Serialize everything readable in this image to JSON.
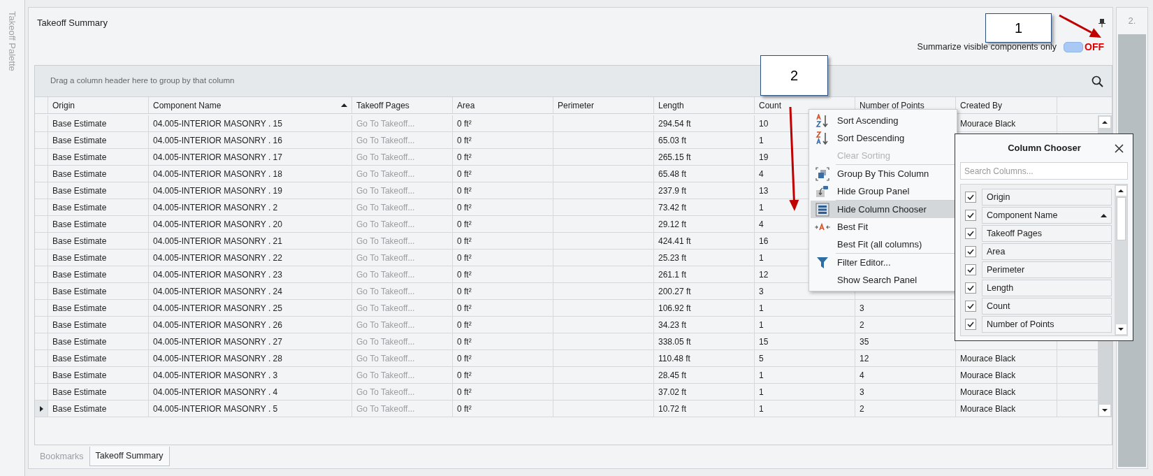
{
  "side_panel": {
    "title": "Takeoff Palette"
  },
  "panel": {
    "title": "Takeoff Summary"
  },
  "summarize": {
    "label": "Summarize visible components only",
    "on": false,
    "state_text": "OFF"
  },
  "callouts": [
    "1",
    "2"
  ],
  "grid": {
    "group_panel_hint": "Drag a column header here to group by that column",
    "columns": [
      {
        "label": "Origin",
        "sorted": false
      },
      {
        "label": "Component Name",
        "sorted": true
      },
      {
        "label": "Takeoff Pages",
        "sorted": false
      },
      {
        "label": "Area",
        "sorted": false
      },
      {
        "label": "Perimeter",
        "sorted": false
      },
      {
        "label": "Length",
        "sorted": false
      },
      {
        "label": "Count",
        "sorted": false
      },
      {
        "label": "Number of Points",
        "sorted": false
      },
      {
        "label": "Created By",
        "sorted": false
      }
    ],
    "rows": [
      {
        "origin": "Base Estimate",
        "component": "04.005-INTERIOR MASONRY . 15",
        "takeoff_pages": "Go To Takeoff...",
        "area": "0 ft²",
        "length": "294.54 ft",
        "count": "10",
        "created_by": "Mourace Black",
        "current": false
      },
      {
        "origin": "Base Estimate",
        "component": "04.005-INTERIOR MASONRY . 16",
        "takeoff_pages": "Go To Takeoff...",
        "area": "0 ft²",
        "length": "65.03 ft",
        "count": "1",
        "current": false
      },
      {
        "origin": "Base Estimate",
        "component": "04.005-INTERIOR MASONRY . 17",
        "takeoff_pages": "Go To Takeoff...",
        "area": "0 ft²",
        "length": "265.15 ft",
        "count": "19",
        "current": false
      },
      {
        "origin": "Base Estimate",
        "component": "04.005-INTERIOR MASONRY . 18",
        "takeoff_pages": "Go To Takeoff...",
        "area": "0 ft²",
        "length": "65.48 ft",
        "count": "4",
        "current": false
      },
      {
        "origin": "Base Estimate",
        "component": "04.005-INTERIOR MASONRY . 19",
        "takeoff_pages": "Go To Takeoff...",
        "area": "0 ft²",
        "length": "237.9 ft",
        "count": "13",
        "current": false
      },
      {
        "origin": "Base Estimate",
        "component": "04.005-INTERIOR MASONRY . 2",
        "takeoff_pages": "Go To Takeoff...",
        "area": "0 ft²",
        "length": "73.42 ft",
        "count": "1",
        "current": false
      },
      {
        "origin": "Base Estimate",
        "component": "04.005-INTERIOR MASONRY . 20",
        "takeoff_pages": "Go To Takeoff...",
        "area": "0 ft²",
        "length": "29.12 ft",
        "count": "4",
        "current": false
      },
      {
        "origin": "Base Estimate",
        "component": "04.005-INTERIOR MASONRY . 21",
        "takeoff_pages": "Go To Takeoff...",
        "area": "0 ft²",
        "length": "424.41 ft",
        "count": "16",
        "current": false
      },
      {
        "origin": "Base Estimate",
        "component": "04.005-INTERIOR MASONRY . 22",
        "takeoff_pages": "Go To Takeoff...",
        "area": "0 ft²",
        "length": "25.23 ft",
        "count": "1",
        "current": false
      },
      {
        "origin": "Base Estimate",
        "component": "04.005-INTERIOR MASONRY . 23",
        "takeoff_pages": "Go To Takeoff...",
        "area": "0 ft²",
        "length": "261.1 ft",
        "count": "12",
        "current": false
      },
      {
        "origin": "Base Estimate",
        "component": "04.005-INTERIOR MASONRY . 24",
        "takeoff_pages": "Go To Takeoff...",
        "area": "0 ft²",
        "length": "200.27 ft",
        "count": "3",
        "current": false
      },
      {
        "origin": "Base Estimate",
        "component": "04.005-INTERIOR MASONRY . 25",
        "takeoff_pages": "Go To Takeoff...",
        "area": "0 ft²",
        "length": "106.92 ft",
        "count": "1",
        "number_of_points": "3",
        "current": false
      },
      {
        "origin": "Base Estimate",
        "component": "04.005-INTERIOR MASONRY . 26",
        "takeoff_pages": "Go To Takeoff...",
        "area": "0 ft²",
        "length": "34.23 ft",
        "count": "1",
        "number_of_points": "2",
        "current": false
      },
      {
        "origin": "Base Estimate",
        "component": "04.005-INTERIOR MASONRY . 27",
        "takeoff_pages": "Go To Takeoff...",
        "area": "0 ft²",
        "length": "338.05 ft",
        "count": "15",
        "number_of_points": "35",
        "current": false
      },
      {
        "origin": "Base Estimate",
        "component": "04.005-INTERIOR MASONRY . 28",
        "takeoff_pages": "Go To Takeoff...",
        "area": "0 ft²",
        "length": "110.48 ft",
        "count": "5",
        "number_of_points": "12",
        "created_by": "Mourace Black",
        "current": false
      },
      {
        "origin": "Base Estimate",
        "component": "04.005-INTERIOR MASONRY . 3",
        "takeoff_pages": "Go To Takeoff...",
        "area": "0 ft²",
        "length": "28.45 ft",
        "count": "1",
        "number_of_points": "4",
        "created_by": "Mourace Black",
        "current": false
      },
      {
        "origin": "Base Estimate",
        "component": "04.005-INTERIOR MASONRY . 4",
        "takeoff_pages": "Go To Takeoff...",
        "area": "0 ft²",
        "length": "37.02 ft",
        "count": "1",
        "number_of_points": "3",
        "created_by": "Mourace Black",
        "current": false
      },
      {
        "origin": "Base Estimate",
        "component": "04.005-INTERIOR MASONRY . 5",
        "takeoff_pages": "Go To Takeoff...",
        "area": "0 ft²",
        "length": "10.72 ft",
        "count": "1",
        "number_of_points": "2",
        "created_by": "Mourace Black",
        "current": true
      }
    ]
  },
  "context_menu": {
    "items": [
      {
        "label": "Sort Ascending",
        "kind": "sort_asc",
        "disabled": false,
        "highlighted": false,
        "separator_before": false
      },
      {
        "label": "Sort Descending",
        "kind": "sort_desc",
        "disabled": false,
        "highlighted": false,
        "separator_before": false
      },
      {
        "label": "Clear Sorting",
        "kind": "plain",
        "disabled": true,
        "highlighted": false,
        "separator_before": false
      },
      {
        "label": "Group By This Column",
        "kind": "group",
        "disabled": false,
        "highlighted": false,
        "separator_before": true
      },
      {
        "label": "Hide Group Panel",
        "kind": "group_panel",
        "disabled": false,
        "highlighted": false,
        "separator_before": false
      },
      {
        "label": "Hide Column Chooser",
        "kind": "column_chooser",
        "disabled": false,
        "highlighted": true,
        "separator_before": true
      },
      {
        "label": "Best Fit",
        "kind": "best_fit",
        "disabled": false,
        "highlighted": false,
        "separator_before": false
      },
      {
        "label": "Best Fit (all columns)",
        "kind": "plain",
        "disabled": false,
        "highlighted": false,
        "separator_before": false
      },
      {
        "label": "Filter Editor...",
        "kind": "filter",
        "disabled": false,
        "highlighted": false,
        "separator_before": true
      },
      {
        "label": "Show Search Panel",
        "kind": "plain",
        "disabled": false,
        "highlighted": false,
        "separator_before": false
      }
    ]
  },
  "column_chooser": {
    "title": "Column Chooser",
    "search_placeholder": "Search Columns...",
    "items": [
      {
        "label": "Origin",
        "checked": true,
        "sorted": false
      },
      {
        "label": "Component Name",
        "checked": true,
        "sorted": true
      },
      {
        "label": "Takeoff Pages",
        "checked": true,
        "sorted": false
      },
      {
        "label": "Area",
        "checked": true,
        "sorted": false
      },
      {
        "label": "Perimeter",
        "checked": true,
        "sorted": false
      },
      {
        "label": "Length",
        "checked": true,
        "sorted": false
      },
      {
        "label": "Count",
        "checked": true,
        "sorted": false
      },
      {
        "label": "Number of Points",
        "checked": true,
        "sorted": false
      }
    ]
  },
  "tabs": [
    {
      "label": "Bookmarks",
      "selected": false
    },
    {
      "label": "Takeoff Summary",
      "selected": true
    }
  ],
  "right_strip": {
    "label": "2."
  }
}
